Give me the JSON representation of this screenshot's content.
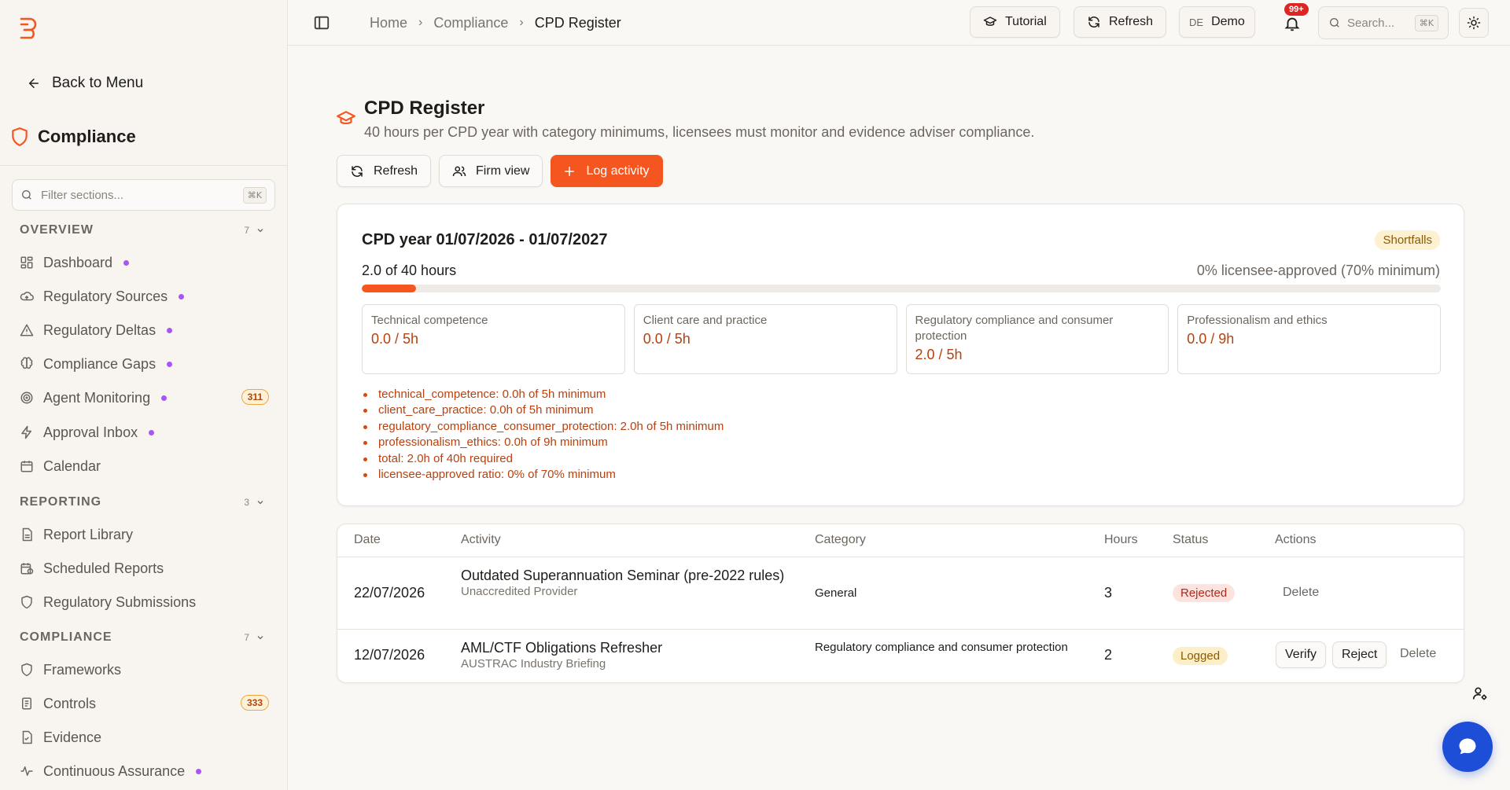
{
  "sidebar": {
    "back_label": "Back to Menu",
    "module_title": "Compliance",
    "filter_placeholder": "Filter sections...",
    "filter_shortcut": "⌘K",
    "sections": [
      {
        "title": "OVERVIEW",
        "count": "7",
        "items": [
          {
            "label": "Dashboard",
            "icon": "dashboard-icon",
            "dot": true
          },
          {
            "label": "Regulatory Sources",
            "icon": "cloud-icon",
            "dot": true
          },
          {
            "label": "Regulatory Deltas",
            "icon": "warning-icon",
            "dot": true
          },
          {
            "label": "Compliance Gaps",
            "icon": "brain-icon",
            "dot": true
          },
          {
            "label": "Agent Monitoring",
            "icon": "radar-icon",
            "dot": true,
            "badge": "311"
          },
          {
            "label": "Approval Inbox",
            "icon": "lightning-icon",
            "dot": true
          },
          {
            "label": "Calendar",
            "icon": "calendar-icon",
            "dot": false
          }
        ]
      },
      {
        "title": "REPORTING",
        "count": "3",
        "items": [
          {
            "label": "Report Library",
            "icon": "document-icon",
            "dot": false
          },
          {
            "label": "Scheduled Reports",
            "icon": "calendar-clock-icon",
            "dot": false
          },
          {
            "label": "Regulatory Submissions",
            "icon": "shield-icon",
            "dot": false
          }
        ]
      },
      {
        "title": "COMPLIANCE",
        "count": "7",
        "items": [
          {
            "label": "Frameworks",
            "icon": "shield-icon",
            "dot": false
          },
          {
            "label": "Controls",
            "icon": "clipboard-icon",
            "dot": false,
            "badge": "333"
          },
          {
            "label": "Evidence",
            "icon": "file-check-icon",
            "dot": false
          },
          {
            "label": "Continuous Assurance",
            "icon": "pulse-icon",
            "dot": true
          }
        ]
      }
    ]
  },
  "topbar": {
    "breadcrumb": [
      "Home",
      "Compliance",
      "CPD Register"
    ],
    "tutorial_label": "Tutorial",
    "refresh_label": "Refresh",
    "user_initials": "DE",
    "user_name": "Demo",
    "notifications_badge": "99+",
    "search_placeholder": "Search...",
    "search_shortcut": "⌘K"
  },
  "page": {
    "title": "CPD Register",
    "subtitle": "40 hours per CPD year with category minimums, licensees must monitor and evidence adviser compliance.",
    "actions": {
      "refresh": "Refresh",
      "firm_view": "Firm view",
      "log_activity": "Log activity"
    }
  },
  "summary": {
    "year_title": "CPD year 01/07/2026 - 01/07/2027",
    "status_badge": "Shortfalls",
    "hours_label": "2.0 of 40 hours",
    "approved_label": "0% licensee-approved (70% minimum)",
    "progress_fraction": 0.05,
    "categories": [
      {
        "name": "Technical competence",
        "value": "0.0 / 5h"
      },
      {
        "name": "Client care and practice",
        "value": "0.0 / 5h"
      },
      {
        "name": "Regulatory compliance and consumer protection",
        "value": "2.0 / 5h"
      },
      {
        "name": "Professionalism and ethics",
        "value": "0.0 / 9h"
      }
    ],
    "issues": [
      "technical_competence: 0.0h of 5h minimum",
      "client_care_practice: 0.0h of 5h minimum",
      "regulatory_compliance_consumer_protection: 2.0h of 5h minimum",
      "professionalism_ethics: 0.0h of 9h minimum",
      "total: 2.0h of 40h required",
      "licensee-approved ratio: 0% of 70% minimum"
    ]
  },
  "table": {
    "headers": [
      "Date",
      "Activity",
      "Category",
      "Hours",
      "Status",
      "Actions"
    ],
    "rows": [
      {
        "date": "22/07/2026",
        "activity": "Outdated Superannuation Seminar (pre-2022 rules)",
        "provider": "Unaccredited Provider",
        "category": "General",
        "hours": "3",
        "status": "Rejected",
        "actions": [
          "Delete"
        ]
      },
      {
        "date": "12/07/2026",
        "activity": "AML/CTF Obligations Refresher",
        "provider": "AUSTRAC Industry Briefing",
        "category": "Regulatory compliance and consumer protection",
        "hours": "2",
        "status": "Logged",
        "actions": [
          "Verify",
          "Reject",
          "Delete"
        ]
      }
    ]
  },
  "colors": {
    "accent": "#f5561f",
    "dot": "#a855f7",
    "warning_text": "#b8410f",
    "chat": "#1d4ed8"
  }
}
